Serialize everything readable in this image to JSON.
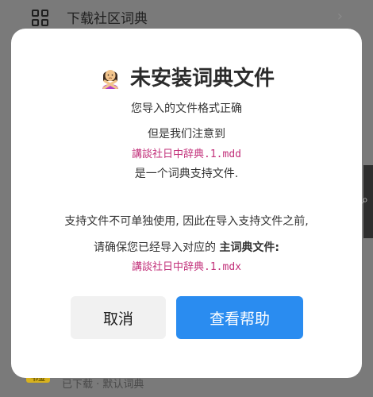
{
  "background": {
    "top_title": "下载社区词典",
    "bottom_badge": "书签",
    "bottom_text": "已下载 · 默认词典"
  },
  "dialog": {
    "title": "未安装词典文件",
    "title_icon": "woman-gesturing-no-emoji",
    "line1": "您导入的文件格式正确",
    "line2": "但是我们注意到",
    "mdd_filename": "講談社日中辞典.1.mdd",
    "line3": "是一个词典支持文件.",
    "line4": "支持文件不可单独使用, 因此在导入支持文件之前,",
    "line5_prefix": "请确保您已经导入对应的",
    "line5_bold": "主词典文件:",
    "mdx_filename": "講談社日中辞典.1.mdx",
    "cancel_label": "取消",
    "help_label": "查看帮助"
  },
  "colors": {
    "accent_button": "#2a8cf0",
    "filename_color": "#c2307a",
    "overlay": "#7a7a7a"
  }
}
